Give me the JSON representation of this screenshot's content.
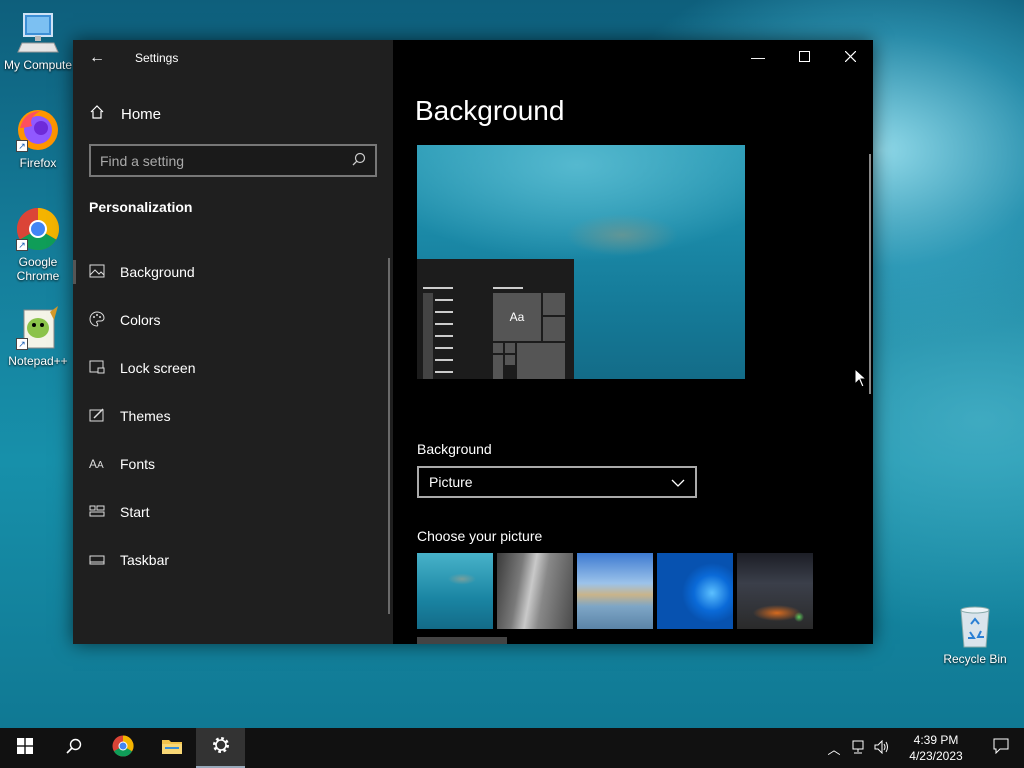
{
  "desktop": {
    "icons": [
      {
        "label": "My Compute",
        "icon": "computer-icon"
      },
      {
        "label": "Firefox",
        "icon": "firefox-icon"
      },
      {
        "label": "Google Chrome",
        "icon": "chrome-icon"
      },
      {
        "label": "Notepad++",
        "icon": "notepadpp-icon"
      }
    ],
    "recycle_bin": {
      "label": "Recycle Bin",
      "icon": "recycle-bin-icon"
    }
  },
  "settings": {
    "app_title": "Settings",
    "home_label": "Home",
    "search_placeholder": "Find a setting",
    "section_title": "Personalization",
    "nav_items": [
      {
        "label": "Background",
        "icon": "picture-icon",
        "selected": true
      },
      {
        "label": "Colors",
        "icon": "palette-icon",
        "selected": false
      },
      {
        "label": "Lock screen",
        "icon": "lock-screen-icon",
        "selected": false
      },
      {
        "label": "Themes",
        "icon": "themes-icon",
        "selected": false
      },
      {
        "label": "Fonts",
        "icon": "fonts-icon",
        "selected": false
      },
      {
        "label": "Start",
        "icon": "start-icon",
        "selected": false
      },
      {
        "label": "Taskbar",
        "icon": "taskbar-icon",
        "selected": false
      }
    ],
    "page_title": "Background",
    "preview_tile_label": "Aa",
    "background_label": "Background",
    "background_value": "Picture",
    "choose_picture_label": "Choose your picture",
    "pictures": [
      "underwater-swimmer",
      "rock-cliff",
      "beach-sunset",
      "windows-blue",
      "night-sky-tent"
    ]
  },
  "taskbar": {
    "buttons": [
      "start-icon",
      "search-icon",
      "chrome-icon",
      "file-explorer-icon",
      "settings-icon"
    ],
    "active": "settings-icon",
    "time": "4:39 PM",
    "date": "4/23/2023"
  },
  "colors": {
    "nav_bg": "#1f1f1f",
    "content_bg": "#000000",
    "taskbar_bg": "#111111"
  }
}
